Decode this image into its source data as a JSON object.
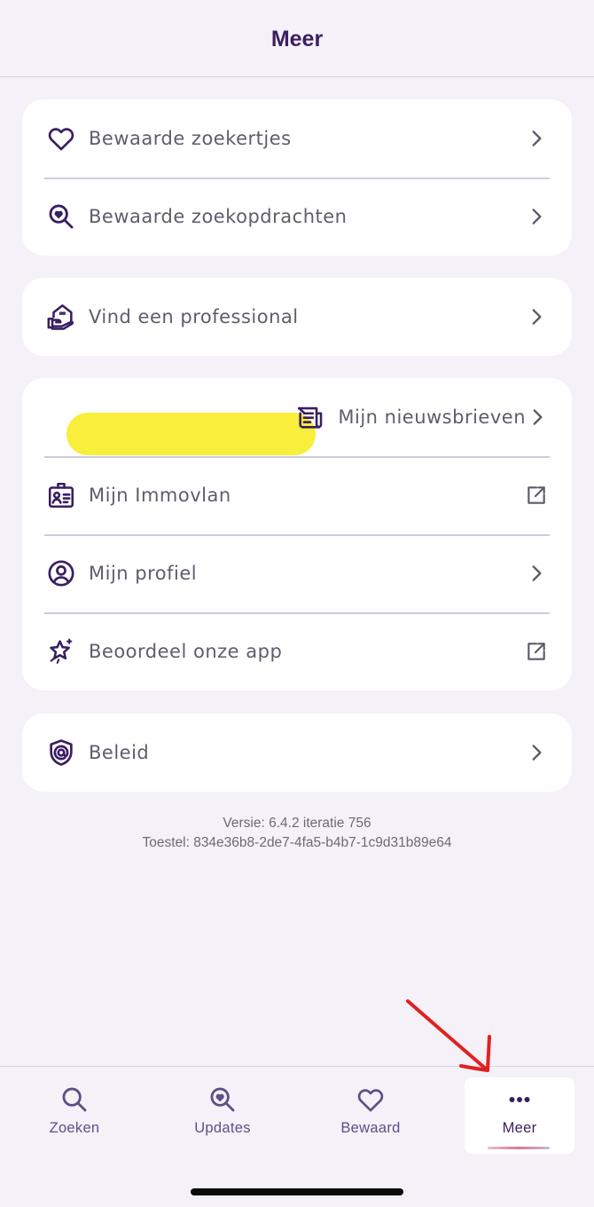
{
  "header": {
    "title": "Meer"
  },
  "groups": [
    {
      "items": [
        {
          "label": "Bewaarde zoekertjes",
          "icon": "heart-icon",
          "action": "chevron-right-icon"
        },
        {
          "label": "Bewaarde zoekopdrachten",
          "icon": "search-heart-icon",
          "action": "chevron-right-icon"
        }
      ]
    },
    {
      "items": [
        {
          "label": "Vind een professional",
          "icon": "house-hand-icon",
          "action": "chevron-right-icon"
        }
      ]
    },
    {
      "items": [
        {
          "label": "Mijn nieuwsbrieven",
          "icon": "newsletter-icon",
          "action": "chevron-right-icon",
          "highlighted": true
        },
        {
          "label": "Mijn Immovlan",
          "icon": "id-card-icon",
          "action": "external-link-icon"
        },
        {
          "label": "Mijn profiel",
          "icon": "user-circle-icon",
          "action": "chevron-right-icon"
        },
        {
          "label": "Beoordeel onze app",
          "icon": "star-sparkle-icon",
          "action": "external-link-icon"
        }
      ]
    },
    {
      "items": [
        {
          "label": "Beleid",
          "icon": "shield-at-icon",
          "action": "chevron-right-icon"
        }
      ]
    }
  ],
  "version": {
    "line1": "Versie: 6.4.2 iteratie 756",
    "line2": "Toestel: 834e36b8-2de7-4fa5-b4b7-1c9d31b89e64"
  },
  "bottom_nav": [
    {
      "label": "Zoeken",
      "icon": "search-icon",
      "active": false
    },
    {
      "label": "Updates",
      "icon": "search-heart-icon",
      "active": false
    },
    {
      "label": "Bewaard",
      "icon": "heart-icon",
      "active": false
    },
    {
      "label": "Meer",
      "icon": "more-dots-icon",
      "active": true
    }
  ],
  "colors": {
    "background": "#f4f1f8",
    "card": "#ffffff",
    "brand_purple": "#3a1e62",
    "highlight_yellow": "#f7ef3b",
    "annotation_red": "#e1211f"
  }
}
